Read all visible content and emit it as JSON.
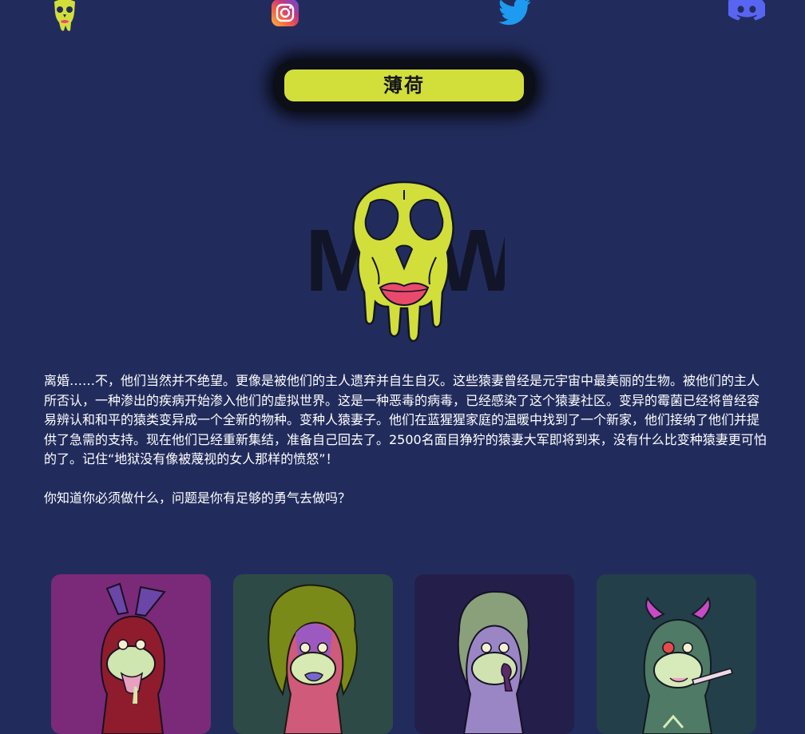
{
  "header": {
    "logo_icon": "skull-logo-icon",
    "social": [
      {
        "icon": "instagram-icon"
      },
      {
        "icon": "twitter-icon"
      },
      {
        "icon": "discord-icon"
      }
    ]
  },
  "collection": {
    "name": "薄荷"
  },
  "hero": {
    "icon": "drip-skull-lips-logo",
    "wordmark_left": "M",
    "wordmark_right": "W"
  },
  "story": {
    "paragraph_1": "离婚……不，他们当然并不绝望。更像是被他们的主人遗弃并自生自灭。这些猿妻曾经是元宇宙中最美丽的生物。被他们的主人所否认，一种渗出的疾病开始渗入他们的虚拟世界。这是一种恶毒的病毒，已经感染了这个猿妻社区。变异的霉菌已经将曾经容易辨认和和平的猿类变异成一个全新的物种。变种人猿妻子。他们在蓝猩猩家庭的温暖中找到了一个新家，他们接纳了他们并提供了急需的支持。现在他们已经重新集结，准备自己回去了。2500名面目狰狞的猿妻大军即将到来，没有什么比变种猿妻更可怕的了。记住“地狱没有像被蔑视的女人那样的愤怒”！",
    "paragraph_2": "你知道你必须做什么，问题是你有足够的勇气去做吗？"
  },
  "gallery": [
    {
      "bg": "#7a2a78",
      "icon": "bunny-ear-mutant-ape-art"
    },
    {
      "bg": "#2e4a47",
      "icon": "wavy-hair-mutant-ape-art"
    },
    {
      "bg": "#231e4a",
      "icon": "silver-hair-mutant-ape-art"
    },
    {
      "bg": "#233f4a",
      "icon": "horned-mutant-ape-art"
    }
  ],
  "colors": {
    "background": "#222c5c",
    "accent": "#d2df3a",
    "lips": "#e94a6c",
    "twitter": "#1d9bf0",
    "discord": "#5865f2"
  }
}
